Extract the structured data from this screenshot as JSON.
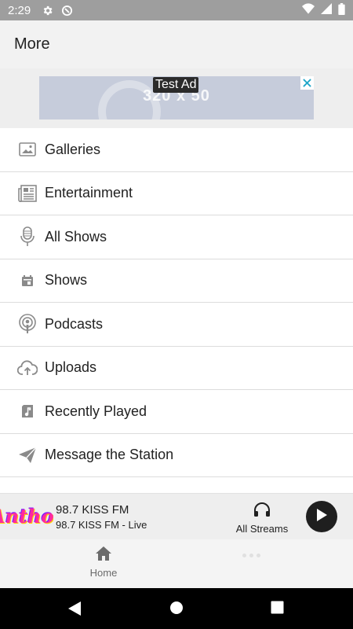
{
  "status_bar": {
    "time": "2:29",
    "icons_left": [
      "settings-gear",
      "sync-circle"
    ],
    "icons_right": [
      "wifi",
      "signal",
      "battery"
    ]
  },
  "header": {
    "title": "More"
  },
  "ad": {
    "label": "Test Ad",
    "size_text": "320 x 50",
    "close_icon": "close-x"
  },
  "menu": {
    "items": [
      {
        "label": "Galleries",
        "icon": "image-icon"
      },
      {
        "label": "Entertainment",
        "icon": "newspaper-icon"
      },
      {
        "label": "All Shows",
        "icon": "microphone-icon"
      },
      {
        "label": "Shows",
        "icon": "calendar-icon"
      },
      {
        "label": "Podcasts",
        "icon": "podcast-icon"
      },
      {
        "label": "Uploads",
        "icon": "cloud-upload-icon"
      },
      {
        "label": "Recently Played",
        "icon": "music-note-icon"
      },
      {
        "label": "Message the Station",
        "icon": "send-icon"
      }
    ]
  },
  "player": {
    "logo_text": "Anthony",
    "station_name": "98.7 KISS FM",
    "station_sub": "98.7 KISS FM - Live",
    "streams_label": "All Streams"
  },
  "bottom_nav": {
    "home_label": "Home"
  },
  "colors": {
    "status_bar": "#9e9e9e",
    "header_bg": "#f2f2f2",
    "ad_bg": "#c6ccdb",
    "ad_close": "#1fa6c9",
    "player_bg": "#eeeeee",
    "play_button": "#1f1f1f"
  }
}
